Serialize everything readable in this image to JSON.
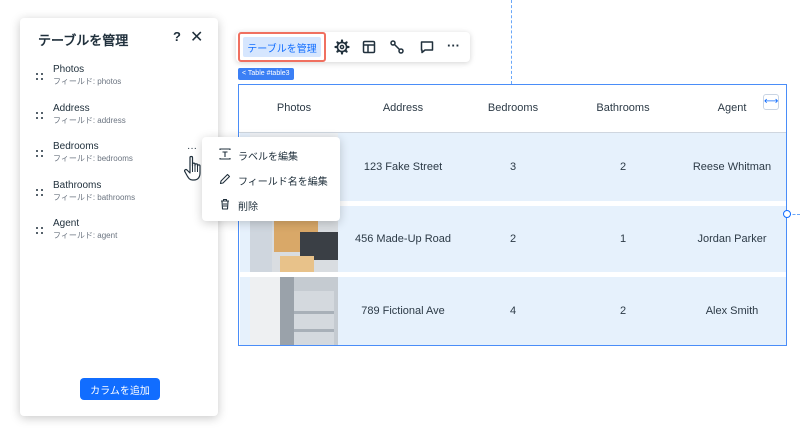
{
  "panel": {
    "title": "テーブルを管理",
    "help": "?",
    "close": "✕",
    "fields": [
      {
        "name": "Photos",
        "key": "フィールド: photos"
      },
      {
        "name": "Address",
        "key": "フィールド: address"
      },
      {
        "name": "Bedrooms",
        "key": "フィールド: bedrooms"
      },
      {
        "name": "Bathrooms",
        "key": "フィールド: bathrooms"
      },
      {
        "name": "Agent",
        "key": "フィールド: agent"
      }
    ],
    "more": "···",
    "add_button": "カラムを追加"
  },
  "context_menu": {
    "items": [
      {
        "label": "ラベルを編集",
        "icon": "text-label-icon"
      },
      {
        "label": "フィールド名を編集",
        "icon": "pencil-icon"
      },
      {
        "label": "削除",
        "icon": "trash-icon"
      }
    ]
  },
  "toolbar": {
    "manage_label": "テーブルを管理",
    "icons": [
      "gear-icon",
      "layout-icon",
      "connect-data-icon",
      "comment-icon",
      "more-icon"
    ],
    "more": "···"
  },
  "table": {
    "tag": "< Table #table3",
    "stretch": "⟷",
    "headers": [
      "Photos",
      "Address",
      "Bedrooms",
      "Bathrooms",
      "Agent"
    ],
    "rows": [
      {
        "address": "123 Fake Street",
        "bedrooms": "3",
        "bathrooms": "2",
        "agent": "Reese Whitman"
      },
      {
        "address": "456 Made-Up Road",
        "bedrooms": "2",
        "bathrooms": "1",
        "agent": "Jordan Parker"
      },
      {
        "address": "789 Fictional Ave",
        "bedrooms": "4",
        "bathrooms": "2",
        "agent": "Alex Smith"
      }
    ]
  },
  "colors": {
    "accent": "#116dff",
    "highlight": "#f07060",
    "row_bg": "#e6f1fc"
  }
}
